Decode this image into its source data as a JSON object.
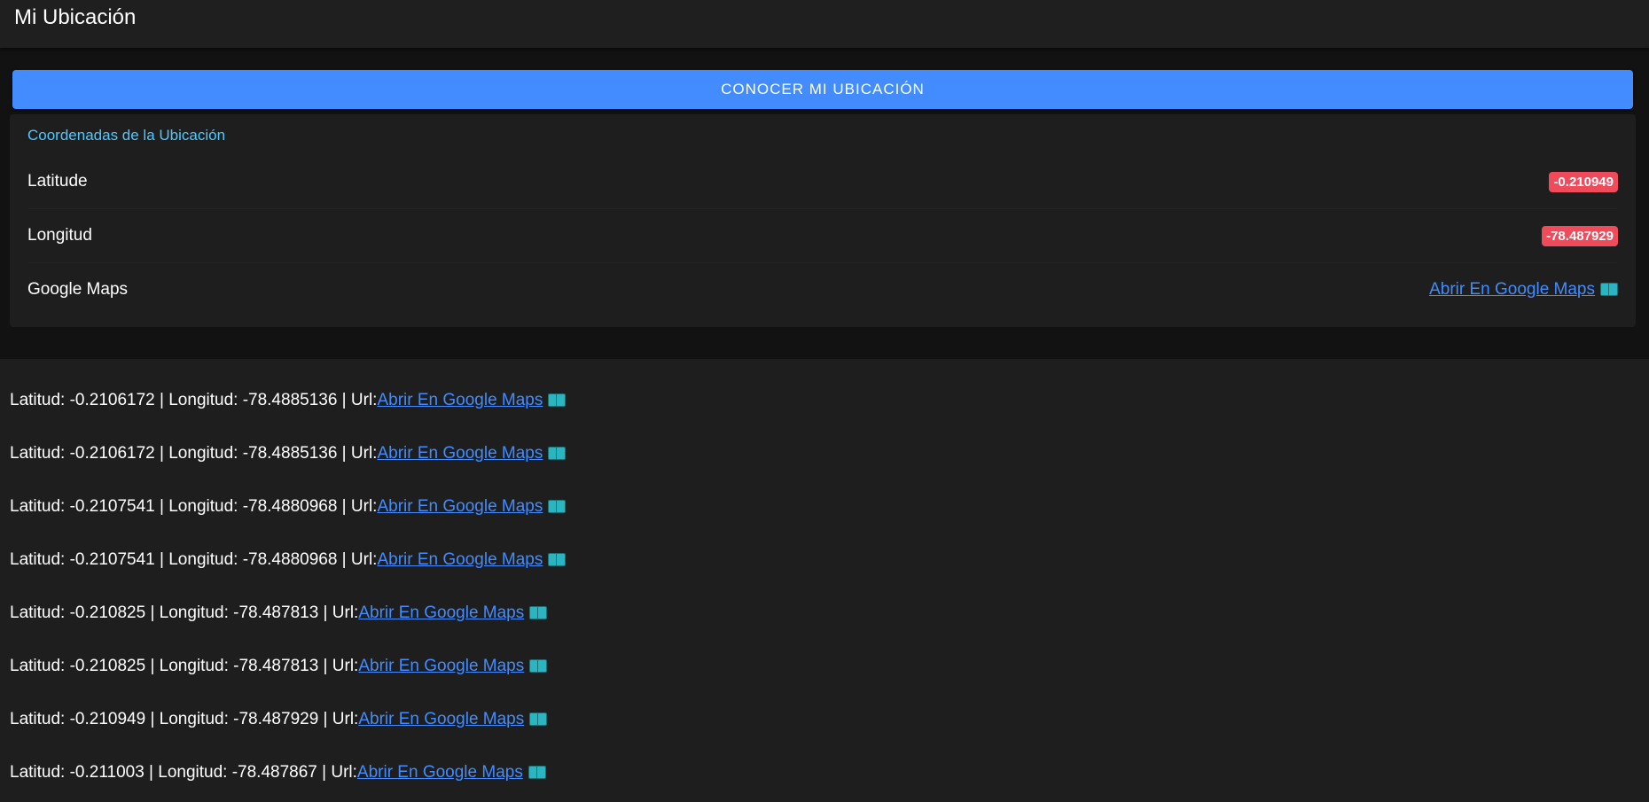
{
  "app": {
    "title": "Mi Ubicación"
  },
  "locate_button_label": "CONOCER MI UBICACIÓN",
  "card": {
    "subtitle": "Coordenadas de la Ubicación",
    "rows": [
      {
        "label": "Latitude",
        "value": "-0.210949"
      },
      {
        "label": "Longitud",
        "value": "-78.487929"
      },
      {
        "label": "Google Maps",
        "link_text": "Abrir En Google Maps"
      }
    ]
  },
  "history": [
    {
      "prefix": "Latitud: -0.2106172 | Longitud: -78.4885136 | Url:",
      "link_text": "Abrir En Google Maps"
    },
    {
      "prefix": "Latitud: -0.2106172 | Longitud: -78.4885136 | Url:",
      "link_text": "Abrir En Google Maps"
    },
    {
      "prefix": "Latitud: -0.2107541 | Longitud: -78.4880968 | Url:",
      "link_text": "Abrir En Google Maps"
    },
    {
      "prefix": "Latitud: -0.2107541 | Longitud: -78.4880968 | Url:",
      "link_text": "Abrir En Google Maps"
    },
    {
      "prefix": "Latitud: -0.210825 | Longitud: -78.487813 | Url:",
      "link_text": "Abrir En Google Maps"
    },
    {
      "prefix": "Latitud: -0.210825 | Longitud: -78.487813 | Url:",
      "link_text": "Abrir En Google Maps"
    },
    {
      "prefix": "Latitud: -0.210949 | Longitud: -78.487929 | Url:",
      "link_text": "Abrir En Google Maps"
    },
    {
      "prefix": "Latitud: -0.211003 | Longitud: -78.487867 | Url:",
      "link_text": "Abrir En Google Maps"
    }
  ],
  "icons": {
    "map_link_icon": "open-book-icon"
  },
  "colors": {
    "accent": "#428cff",
    "badge": "#f04b5b",
    "subtitle": "#50c8ff"
  }
}
